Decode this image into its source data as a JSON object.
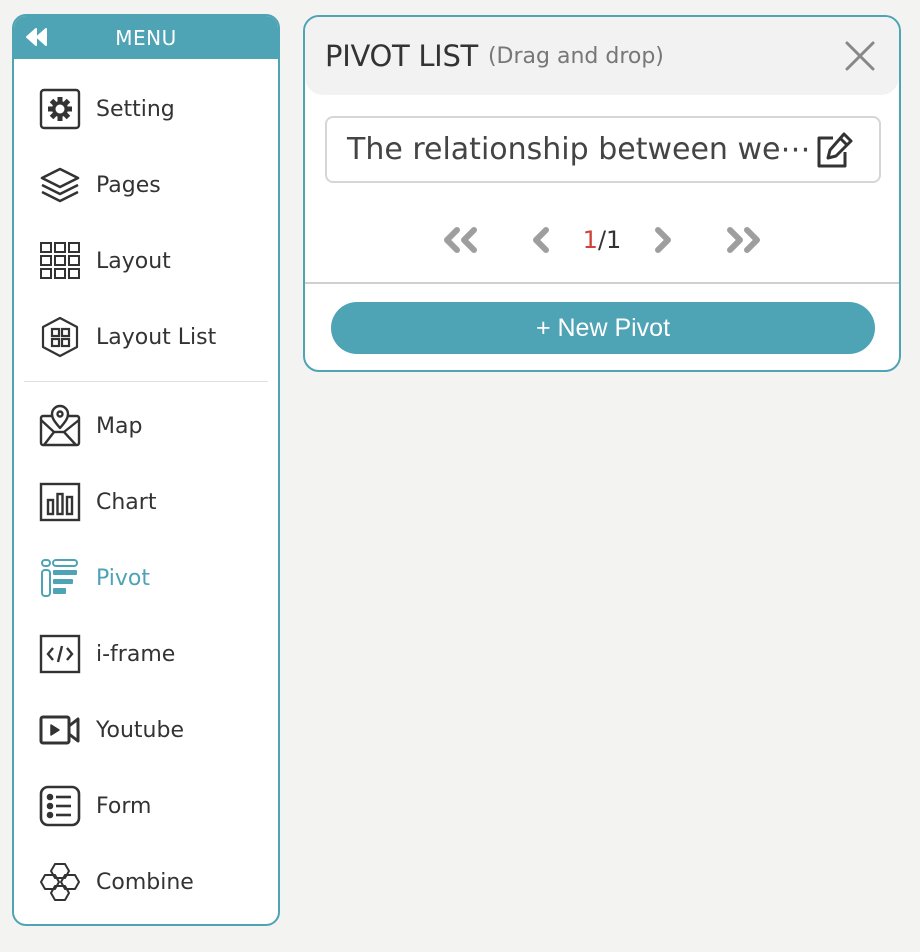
{
  "menu": {
    "title": "MENU",
    "collapse_icon": "double-chevron-left",
    "groups": [
      [
        {
          "label": "Setting",
          "icon": "gear-icon"
        },
        {
          "label": "Pages",
          "icon": "layers-icon"
        },
        {
          "label": "Layout",
          "icon": "grid-icon"
        },
        {
          "label": "Layout List",
          "icon": "hexagon-grid-icon"
        }
      ],
      [
        {
          "label": "Map",
          "icon": "map-pin-icon"
        },
        {
          "label": "Chart",
          "icon": "bar-chart-icon"
        },
        {
          "label": "Pivot",
          "icon": "pivot-icon",
          "active": true
        },
        {
          "label": "i-frame",
          "icon": "code-icon"
        },
        {
          "label": "Youtube",
          "icon": "video-camera-icon"
        },
        {
          "label": "Form",
          "icon": "list-icon"
        },
        {
          "label": "Combine",
          "icon": "hexagons-icon"
        }
      ]
    ]
  },
  "panel": {
    "title": "PIVOT LIST",
    "subtitle": "(Drag and drop)",
    "pivot_items": [
      {
        "name": "The relationship between we⋯"
      }
    ],
    "pagination": {
      "current": "1",
      "separator": "/",
      "total": "1"
    },
    "new_button_label": "+ New Pivot"
  },
  "colors": {
    "accent": "#4ea3b5",
    "current_page": "#d0413a",
    "background": "#f3f3f2"
  }
}
